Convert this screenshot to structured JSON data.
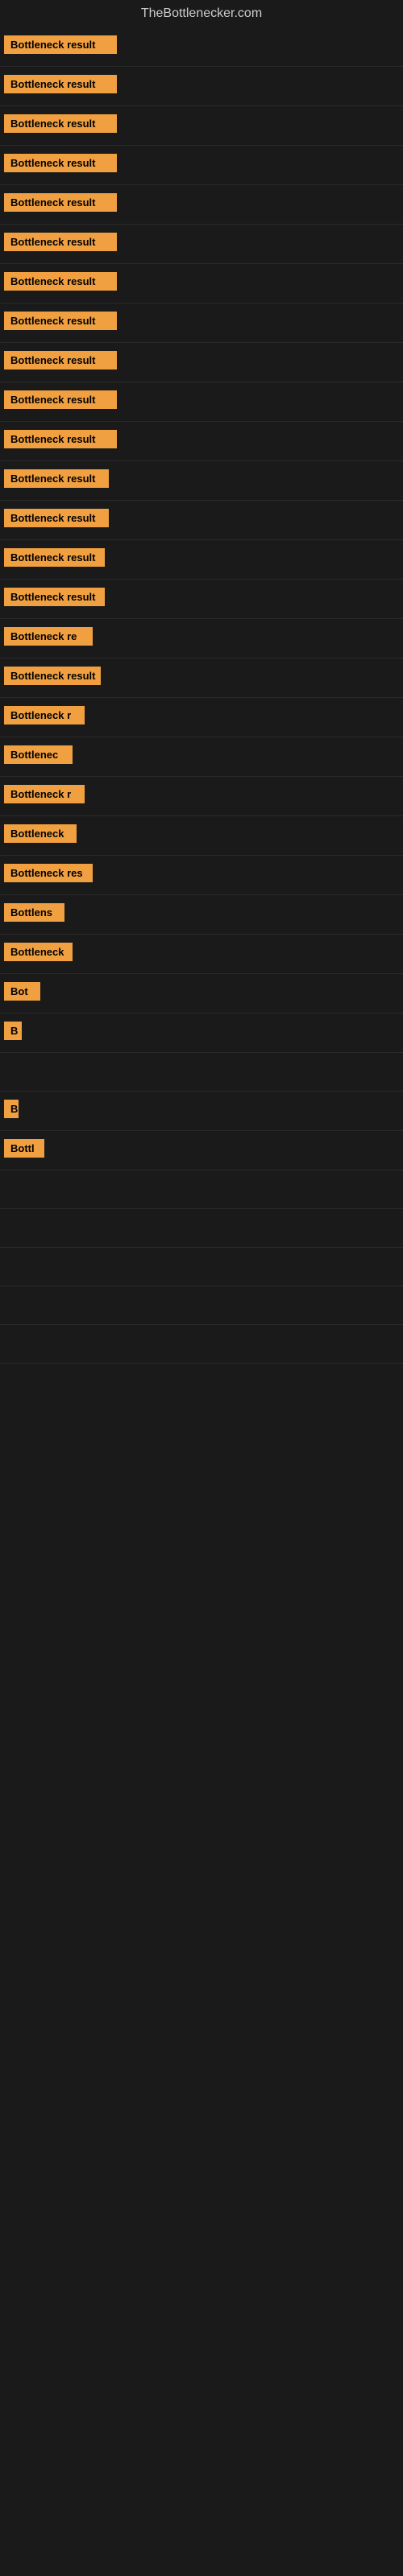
{
  "site": {
    "title": "TheBottlenecker.com"
  },
  "rows": [
    {
      "id": 1,
      "label": "Bottleneck result",
      "width": 140
    },
    {
      "id": 2,
      "label": "Bottleneck result",
      "width": 140
    },
    {
      "id": 3,
      "label": "Bottleneck result",
      "width": 140
    },
    {
      "id": 4,
      "label": "Bottleneck result",
      "width": 140
    },
    {
      "id": 5,
      "label": "Bottleneck result",
      "width": 140
    },
    {
      "id": 6,
      "label": "Bottleneck result",
      "width": 140
    },
    {
      "id": 7,
      "label": "Bottleneck result",
      "width": 140
    },
    {
      "id": 8,
      "label": "Bottleneck result",
      "width": 140
    },
    {
      "id": 9,
      "label": "Bottleneck result",
      "width": 140
    },
    {
      "id": 10,
      "label": "Bottleneck result",
      "width": 140
    },
    {
      "id": 11,
      "label": "Bottleneck result",
      "width": 140
    },
    {
      "id": 12,
      "label": "Bottleneck result",
      "width": 130
    },
    {
      "id": 13,
      "label": "Bottleneck result",
      "width": 130
    },
    {
      "id": 14,
      "label": "Bottleneck result",
      "width": 125
    },
    {
      "id": 15,
      "label": "Bottleneck result",
      "width": 125
    },
    {
      "id": 16,
      "label": "Bottleneck re",
      "width": 110
    },
    {
      "id": 17,
      "label": "Bottleneck result",
      "width": 120
    },
    {
      "id": 18,
      "label": "Bottleneck r",
      "width": 100
    },
    {
      "id": 19,
      "label": "Bottlenec",
      "width": 85
    },
    {
      "id": 20,
      "label": "Bottleneck r",
      "width": 100
    },
    {
      "id": 21,
      "label": "Bottleneck",
      "width": 90
    },
    {
      "id": 22,
      "label": "Bottleneck res",
      "width": 110
    },
    {
      "id": 23,
      "label": "Bottlens",
      "width": 75
    },
    {
      "id": 24,
      "label": "Bottleneck",
      "width": 85
    },
    {
      "id": 25,
      "label": "Bot",
      "width": 45
    },
    {
      "id": 26,
      "label": "B",
      "width": 22
    },
    {
      "id": 27,
      "label": "",
      "width": 0
    },
    {
      "id": 28,
      "label": "B",
      "width": 18
    },
    {
      "id": 29,
      "label": "Bottl",
      "width": 50
    },
    {
      "id": 30,
      "label": "",
      "width": 0
    },
    {
      "id": 31,
      "label": "",
      "width": 0
    },
    {
      "id": 32,
      "label": "",
      "width": 0
    },
    {
      "id": 33,
      "label": "",
      "width": 0
    },
    {
      "id": 34,
      "label": "",
      "width": 0
    }
  ]
}
